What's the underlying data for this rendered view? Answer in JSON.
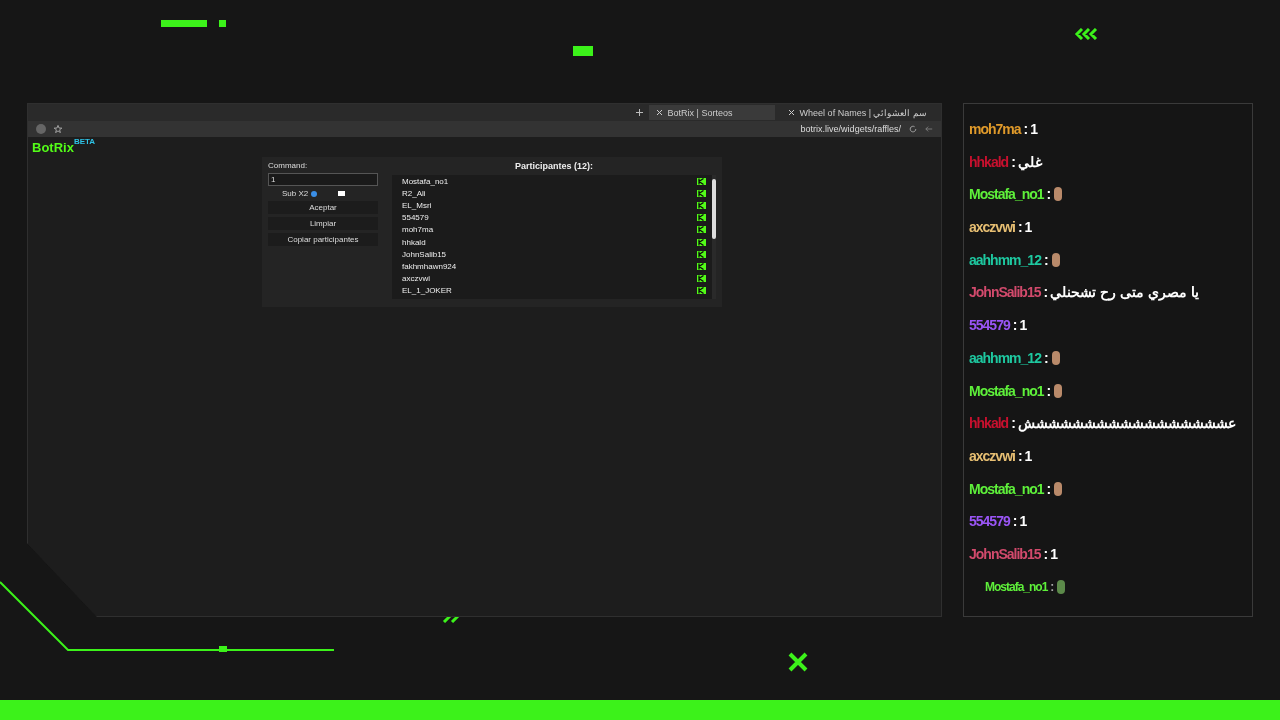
{
  "browser": {
    "tabs": [
      {
        "label": "BotRix | Sorteos",
        "selected": true
      },
      {
        "label": "Wheel of Names | سم العشوائي",
        "selected": false
      }
    ],
    "address": "botrix.live/widgets/raffles/"
  },
  "site": {
    "logo": "BotRix",
    "badge": "BETA"
  },
  "raffle": {
    "command_label": "Command:",
    "command_value": "1",
    "sub_option": {
      "label": "Sub X2",
      "checked": false
    },
    "buttons": [
      "Aceptar",
      "Limpiar",
      "Copiar participantes"
    ],
    "participants_title": "Participantes (12):",
    "participants": [
      "Mostafa_no1",
      "R2_Ali",
      "EL_Msri",
      "554579",
      "moh7ma",
      "hhkald",
      "JohnSalib15",
      "fakhmhawn924",
      "axczvwi",
      "EL_1_JOKER"
    ]
  },
  "chat": [
    {
      "user": "moh7ma",
      "color": "#e09a2a",
      "separator": ":",
      "kind": "text",
      "message": "1",
      "faded": false
    },
    {
      "user": "hhkald",
      "color": "#c8102e",
      "separator": ":",
      "kind": "text",
      "message": "غلي",
      "faded": false
    },
    {
      "user": "Mostafa_no1",
      "color": "#5ef03a",
      "separator": ":",
      "kind": "emote",
      "faded": false
    },
    {
      "user": "axczvwi",
      "color": "#e6be72",
      "separator": ":",
      "kind": "text",
      "message": "1",
      "faded": false
    },
    {
      "user": "aahhmm_12",
      "color": "#1ec8a0",
      "separator": ":",
      "kind": "emote",
      "faded": false
    },
    {
      "user": "JohnSalib15",
      "color": "#d24a6c",
      "separator": ":",
      "kind": "text",
      "message": "يا مصري متى رح تشحنلي",
      "faded": false
    },
    {
      "user": "554579",
      "color": "#9a55f5",
      "separator": ":",
      "kind": "text",
      "message": "1",
      "faded": false
    },
    {
      "user": "aahhmm_12",
      "color": "#1ec8a0",
      "separator": ":",
      "kind": "emote",
      "faded": false
    },
    {
      "user": "Mostafa_no1",
      "color": "#5ef03a",
      "separator": ":",
      "kind": "emote",
      "faded": false
    },
    {
      "user": "hhkald",
      "color": "#c8102e",
      "separator": ":",
      "kind": "text",
      "message": "عششششششششششششششششش",
      "faded": false
    },
    {
      "user": "axczvwi",
      "color": "#e6be72",
      "separator": ":",
      "kind": "text",
      "message": "1",
      "faded": false
    },
    {
      "user": "Mostafa_no1",
      "color": "#5ef03a",
      "separator": ":",
      "kind": "emote",
      "faded": false
    },
    {
      "user": "554579",
      "color": "#9a55f5",
      "separator": ":",
      "kind": "text",
      "message": "1",
      "faded": false
    },
    {
      "user": "JohnSalib15",
      "color": "#d24a6c",
      "separator": ":",
      "kind": "text",
      "message": "1",
      "faded": false
    },
    {
      "user": "Mostafa_no1",
      "color": "#5ef03a",
      "separator": ":",
      "kind": "emote",
      "faded": true
    }
  ]
}
